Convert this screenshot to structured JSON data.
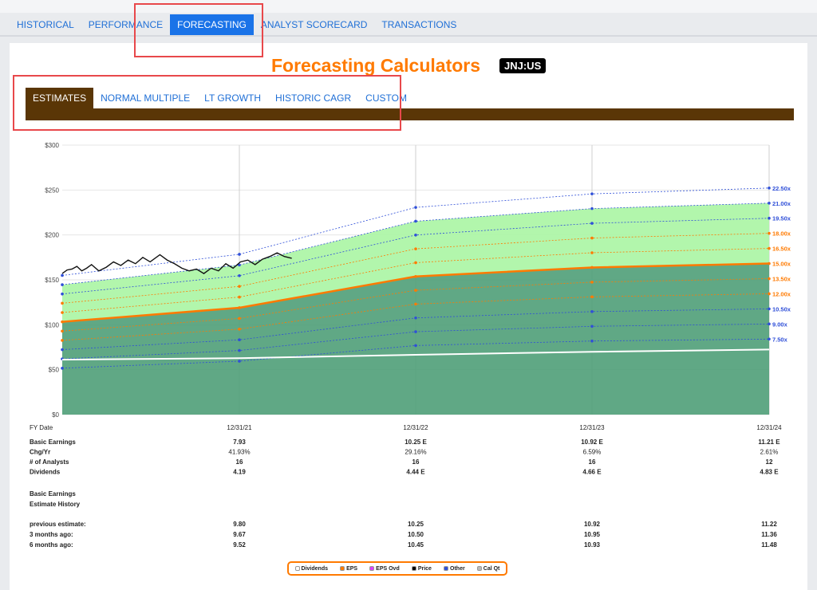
{
  "nav": {
    "tabs": [
      {
        "label": "HISTORICAL"
      },
      {
        "label": "PERFORMANCE"
      },
      {
        "label": "FORECASTING"
      },
      {
        "label": "ANALYST SCORECARD"
      },
      {
        "label": "TRANSACTIONS"
      }
    ],
    "active": 2
  },
  "header": {
    "title": "Forecasting Calculators",
    "ticker": "JNJ:US"
  },
  "subtabs": {
    "tabs": [
      {
        "label": "ESTIMATES"
      },
      {
        "label": "NORMAL MULTIPLE"
      },
      {
        "label": "LT GROWTH"
      },
      {
        "label": "HISTORIC CAGR"
      },
      {
        "label": "CUSTOM"
      }
    ],
    "active": 0
  },
  "chart_data": {
    "type": "area",
    "ylim": [
      0,
      300
    ],
    "y_ticks": [
      "$0",
      "$50",
      "$100",
      "$150",
      "$200",
      "$250",
      "$300"
    ],
    "y_tick_values": [
      0,
      50,
      100,
      150,
      200,
      250,
      300
    ],
    "x_label": "FY Date",
    "x": [
      "12/31/21",
      "12/31/22",
      "12/31/23",
      "12/31/24"
    ],
    "x_start_offset": -0.4,
    "eps": [
      7.93,
      10.25,
      10.92,
      11.21
    ],
    "dividends": [
      4.19,
      4.44,
      4.66,
      4.83
    ],
    "multiples": [
      {
        "label": "22.50x",
        "m": 22.5,
        "color": "#2f4fd8"
      },
      {
        "label": "21.00x",
        "m": 21.0,
        "color": "#2f4fd8"
      },
      {
        "label": "19.50x",
        "m": 19.5,
        "color": "#2f4fd8"
      },
      {
        "label": "18.00x",
        "m": 18.0,
        "color": "#ff7a00"
      },
      {
        "label": "16.50x",
        "m": 16.5,
        "color": "#ff7a00"
      },
      {
        "label": "15.00x",
        "m": 15.0,
        "color": "#ff7a00"
      },
      {
        "label": "13.50x",
        "m": 13.5,
        "color": "#ff7a00"
      },
      {
        "label": "12.00x",
        "m": 12.0,
        "color": "#ff7a00"
      },
      {
        "label": "10.50x",
        "m": 10.5,
        "color": "#2f4fd8"
      },
      {
        "label": "9.00x",
        "m": 9.0,
        "color": "#2f4fd8"
      },
      {
        "label": "7.50x",
        "m": 7.5,
        "color": "#2f4fd8"
      }
    ],
    "normal_multiple": 15.0,
    "price_series": [
      [
        0.0,
        157
      ],
      [
        0.02,
        161
      ],
      [
        0.04,
        162
      ],
      [
        0.06,
        165
      ],
      [
        0.08,
        160
      ],
      [
        0.1,
        163
      ],
      [
        0.12,
        167
      ],
      [
        0.15,
        160
      ],
      [
        0.18,
        164
      ],
      [
        0.21,
        170
      ],
      [
        0.24,
        166
      ],
      [
        0.27,
        172
      ],
      [
        0.3,
        168
      ],
      [
        0.33,
        175
      ],
      [
        0.36,
        170
      ],
      [
        0.4,
        178
      ],
      [
        0.43,
        172
      ],
      [
        0.46,
        168
      ],
      [
        0.49,
        163
      ],
      [
        0.52,
        160
      ],
      [
        0.55,
        162
      ],
      [
        0.58,
        157
      ],
      [
        0.61,
        163
      ],
      [
        0.64,
        160
      ],
      [
        0.67,
        168
      ],
      [
        0.7,
        163
      ],
      [
        0.73,
        170
      ],
      [
        0.76,
        172
      ],
      [
        0.79,
        167
      ],
      [
        0.82,
        173
      ],
      [
        0.85,
        176
      ],
      [
        0.88,
        180
      ],
      [
        0.91,
        176
      ],
      [
        0.94,
        174
      ]
    ],
    "table": {
      "rows": [
        {
          "label": "Basic Earnings",
          "values": [
            "7.93",
            "10.25 E",
            "10.92 E",
            "11.21 E"
          ],
          "bold": true
        },
        {
          "label": "Chg/Yr",
          "values": [
            "41.93%",
            "29.16%",
            "6.59%",
            "2.61%"
          ],
          "bold": false
        },
        {
          "label": "# of Analysts",
          "values": [
            "16",
            "16",
            "16",
            "12"
          ],
          "bold": true
        },
        {
          "label": "Dividends",
          "values": [
            "4.19",
            "4.44 E",
            "4.66 E",
            "4.83 E"
          ],
          "bold": true
        }
      ],
      "history_title_1": "Basic Earnings",
      "history_title_2": "Estimate History",
      "history_rows": [
        {
          "label": "previous estimate:",
          "values": [
            "9.80",
            "10.25",
            "10.92",
            "11.22"
          ]
        },
        {
          "label": "3 months ago:",
          "values": [
            "9.67",
            "10.50",
            "10.95",
            "11.36"
          ]
        },
        {
          "label": "6 months ago:",
          "values": [
            "9.52",
            "10.45",
            "10.93",
            "11.48"
          ]
        }
      ]
    },
    "legend": [
      {
        "label": "Dividends",
        "color": "#ffffff"
      },
      {
        "label": "EPS",
        "color": "#ff7a00"
      },
      {
        "label": "EPS Ovd",
        "color": "#e040fb"
      },
      {
        "label": "Price",
        "color": "#000000"
      },
      {
        "label": "Other",
        "color": "#2f4fd8"
      },
      {
        "label": "Cal Qt",
        "color": "#bbbbbb"
      }
    ]
  }
}
